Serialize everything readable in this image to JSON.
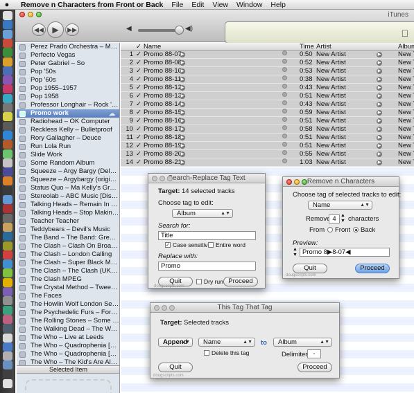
{
  "menubar": {
    "app_name": "Remove n Characters from Front or Back",
    "menus": [
      "File",
      "Edit",
      "View",
      "Window",
      "Help"
    ]
  },
  "itunes": {
    "window_title": "iTunes",
    "sidebar": [
      "Perez Prado Orchestra – Mondo M...",
      "Perfecto Vegas",
      "Peter Gabriel – So",
      "Pop '50s",
      "Pop '60s",
      "Pop 1955–1957",
      "Pop 1958",
      "Professor Longhair – Rock 'n' Roll...",
      "Promo work",
      "Radiohead – OK Computer",
      "Reckless Kelly – Bulletproof",
      "Rory Gallagher – Deuce",
      "Run Lola Run",
      "Slide Work",
      "Some Random Album",
      "Squeeze – Argy Bargy (Deluxe Edit...",
      "Squeeze – Argybargy (original)",
      "Status Quo – Ma Kelly's Greasy Sp...",
      "Stereolab – ABC Music [Disc 2]",
      "Talking Heads – Remain In Light",
      "Talking Heads – Stop Making Sens...",
      "Teacher Teacher",
      "Teddybears – Devil's Music",
      "The Band – The Band: Greatest Hits",
      "The Clash – Clash On Broadway",
      "The Clash – London Calling",
      "The Clash – Super Black Market Cl...",
      "The Clash – The Clash (UK Version)",
      "The Clash MPEG",
      "The Crystal Method – Tweekend",
      "The Faces",
      "The Howlin Wolf London Session",
      "The Psychedelic Furs – Forever Now",
      "The Rolling Stones – Some Girls",
      "The Walking Dead – The Walk...",
      "The Who – Live at Leeds",
      "The Who – Quadrophenia [Disc 1]",
      "The Who – Quadrophenia [Disc 2]",
      "The Who – The Kid's Are Alright"
    ],
    "sidebar_selected": "Promo work",
    "selected_item_header": "Selected Item",
    "columns": {
      "check": "✓",
      "name": "Name",
      "time": "Time",
      "artist": "Artist",
      "album": "Album"
    },
    "tracks": [
      {
        "n": "1",
        "name": "Promo 88-07",
        "time": "0:50",
        "artist": "New Artist",
        "album": "New Title"
      },
      {
        "n": "2",
        "name": "Promo 88-08",
        "time": "0:52",
        "artist": "New Artist",
        "album": "New Title"
      },
      {
        "n": "3",
        "name": "Promo 88-10",
        "time": "0:53",
        "artist": "New Artist",
        "album": "New Title"
      },
      {
        "n": "4",
        "name": "Promo 88-11",
        "time": "0:38",
        "artist": "New Artist",
        "album": "New Title"
      },
      {
        "n": "5",
        "name": "Promo 88-12",
        "time": "0:43",
        "artist": "New Artist",
        "album": "New Title"
      },
      {
        "n": "6",
        "name": "Promo 88-13",
        "time": "0:51",
        "artist": "New Artist",
        "album": "New Title"
      },
      {
        "n": "7",
        "name": "Promo 88-14",
        "time": "0:43",
        "artist": "New Artist",
        "album": "New Title"
      },
      {
        "n": "8",
        "name": "Promo 88-15",
        "time": "0:59",
        "artist": "New Artist",
        "album": "New Title"
      },
      {
        "n": "9",
        "name": "Promo 88-16",
        "time": "0:51",
        "artist": "New Artist",
        "album": "New Title"
      },
      {
        "n": "10",
        "name": "Promo 88-17",
        "time": "0:58",
        "artist": "New Artist",
        "album": "New Title"
      },
      {
        "n": "11",
        "name": "Promo 88-18",
        "time": "0:51",
        "artist": "New Artist",
        "album": "New Title"
      },
      {
        "n": "12",
        "name": "Promo 88-19",
        "time": "0:51",
        "artist": "New Artist",
        "album": "New Title"
      },
      {
        "n": "13",
        "name": "Promo 88-20",
        "time": "0:55",
        "artist": "New Artist",
        "album": "New Title"
      },
      {
        "n": "14",
        "name": "Promo 88-21",
        "time": "1:03",
        "artist": "New Artist",
        "album": "New Title"
      }
    ]
  },
  "search_replace": {
    "title": "Search-Replace Tag Text",
    "target_label": "Target:",
    "target_value": "14 selected tracks",
    "choose_label": "Choose tag to edit:",
    "tag": "Album",
    "search_label": "Search for:",
    "search_value": "Title",
    "case_sensitive": "Case sensitive",
    "entire_word": "Entire word",
    "replace_label": "Replace with:",
    "replace_value": "Promo",
    "quit": "Quit",
    "dry_run": "Dry run",
    "proceed": "Proceed",
    "footer": "dougscripts.com"
  },
  "remove_n": {
    "title": "Remove n Characters",
    "choose_label": "Choose tag of selected tracks to edit:",
    "tag": "Name",
    "remove_label": "Remove",
    "count": "4",
    "characters_label": "characters",
    "from_label": "From",
    "front_label": "Front",
    "back_label": "Back",
    "preview_label": "Preview:",
    "preview_value": "Promo 8▶8-07◀",
    "quit": "Quit",
    "proceed": "Proceed",
    "footer": "dougscripts.com"
  },
  "this_tag": {
    "title": "This Tag That Tag",
    "target_label": "Target:",
    "target_value": "Selected tracks",
    "action": "Append",
    "source_tag": "Name",
    "to_label": "to",
    "dest_tag": "Album",
    "delete_label": "Delete this tag",
    "delimiter_label": "Delimiter:",
    "delimiter_value": "-",
    "quit": "Quit",
    "proceed": "Proceed",
    "footer": "dougscripts.com"
  }
}
